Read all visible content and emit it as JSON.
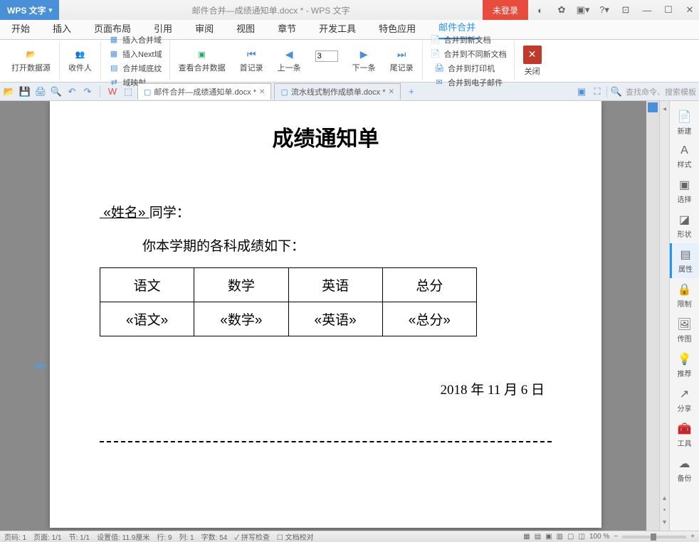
{
  "titleBar": {
    "appName": "WPS 文字",
    "docTitle": "邮件合并—成绩通知单.docx * - WPS 文字",
    "notLogin": "未登录"
  },
  "menu": {
    "items": [
      "开始",
      "插入",
      "页面布局",
      "引用",
      "审阅",
      "视图",
      "章节",
      "开发工具",
      "特色应用",
      "邮件合并"
    ],
    "activeIndex": 9
  },
  "ribbon": {
    "openData": "打开数据源",
    "recipients": "收件人",
    "insertMergeField": "插入合并域",
    "mergeFieldShading": "合并域底纹",
    "insertNextField": "插入Next域",
    "fieldMapping": "域映射",
    "viewMergeData": "查看合并数据",
    "firstRecord": "首记录",
    "prevRecord": "上一条",
    "pageNum": "3",
    "nextRecord": "下一条",
    "lastRecord": "尾记录",
    "mergeToNewDoc": "合并到新文档",
    "mergeToDiffDoc": "合并到不同新文档",
    "mergeToPrinter": "合并到打印机",
    "mergeToEmail": "合并到电子邮件",
    "close": "关闭"
  },
  "docTabs": {
    "tab1": "邮件合并—成绩通知单.docx *",
    "tab2": "流水线式制作成绩单.docx *",
    "searchPlaceholder": "查找命令、搜索模板"
  },
  "document": {
    "title": "成绩通知单",
    "nameField": "«姓名»",
    "nameSuffix": "同学：",
    "subtitle": "你本学期的各科成绩如下：",
    "headers": [
      "语文",
      "数学",
      "英语",
      "总分"
    ],
    "fields": [
      "«语文»",
      "«数学»",
      "«英语»",
      "«总分»"
    ],
    "date": "2018 年 11 月 6 日"
  },
  "sidePanel": {
    "items": [
      "新建",
      "样式",
      "选择",
      "形状",
      "属性",
      "限制",
      "传图",
      "推荐",
      "分享",
      "工具",
      "备份"
    ]
  },
  "statusBar": {
    "page": "页码: 1",
    "pages": "页面: 1/1",
    "section": "节: 1/1",
    "setValue": "设置值: 11.9厘米",
    "row": "行: 9",
    "col": "列: 1",
    "chars": "字数: 54",
    "spellcheck": "拼写检查",
    "docProof": "文档校对",
    "zoom": "100 %"
  }
}
